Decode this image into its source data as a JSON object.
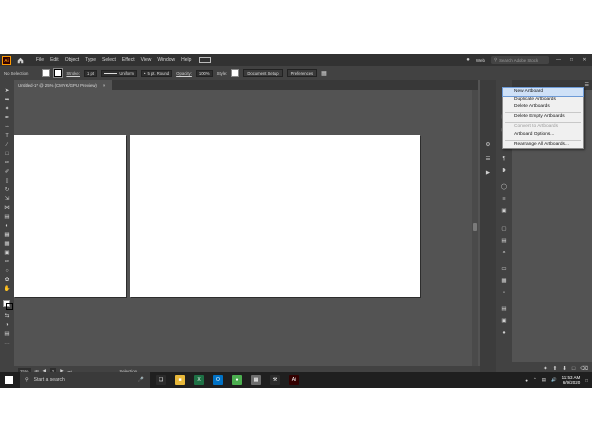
{
  "menubar": {
    "logo": "Ai",
    "menus": [
      "File",
      "Edit",
      "Object",
      "Type",
      "Select",
      "Effect",
      "View",
      "Window",
      "Help"
    ],
    "workspace": "Web",
    "search_placeholder": "Search Adobe Stock",
    "window_buttons": [
      "—",
      "□",
      "✕"
    ]
  },
  "control_bar": {
    "selection_label": "No Selection",
    "stroke_label": "Stroke:",
    "stroke_weight": "1 pt",
    "profile": "Uniform",
    "brush": "5 pt. Round",
    "opacity_label": "Opacity:",
    "opacity_value": "100%",
    "style_label": "Style:",
    "document_setup": "Document Setup",
    "preferences": "Preferences"
  },
  "document_tab": {
    "title": "Untitled-1* @ 25% (CMYK/GPU Preview)",
    "close": "×"
  },
  "status_bar": {
    "zoom": "25%",
    "artboard_number": "2",
    "tool": "Selection"
  },
  "artboards_menu": {
    "items": [
      {
        "label": "New Artboard",
        "highlighted": true,
        "disabled": false
      },
      {
        "label": "Duplicate Artboards",
        "highlighted": false,
        "disabled": false
      },
      {
        "label": "Delete Artboards",
        "highlighted": false,
        "disabled": false
      },
      {
        "label": "Delete Empty Artboards",
        "highlighted": false,
        "disabled": false
      },
      {
        "label": "Convert to Artboards",
        "highlighted": false,
        "disabled": true
      },
      {
        "label": "Artboard Options...",
        "highlighted": false,
        "disabled": false
      },
      {
        "label": "Rearrange All Artboards...",
        "highlighted": false,
        "disabled": false
      }
    ]
  },
  "taskbar": {
    "search_placeholder": "Start a search",
    "apps": [
      "Task View",
      "File Explorer",
      "Excel",
      "Outlook",
      "Chrome",
      "Calculator",
      "Tools",
      "Illustrator"
    ],
    "app_glyphs": [
      "❑",
      "■",
      "X",
      "O",
      "●",
      "▦",
      "⚒",
      "Ai"
    ],
    "app_colors": [
      "#2b2b2b",
      "#e8b83a",
      "#1e7145",
      "#0072c6",
      "#4caf50",
      "#6d6d6d",
      "#2b2b2b",
      "#330000"
    ],
    "time": "11:53 AM",
    "date": "6/9/2020"
  },
  "colors": {
    "app_bg": "#535353",
    "menubar_bg": "#323232",
    "artboard": "#ffffff",
    "menu_highlight": "#cfe1f7",
    "taskbar_bg": "#1f1f1f"
  }
}
